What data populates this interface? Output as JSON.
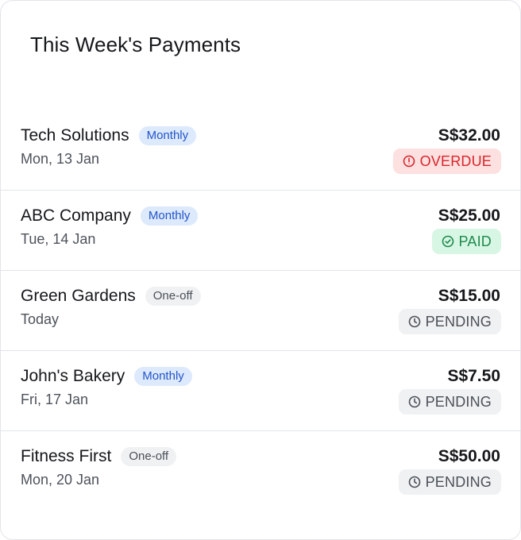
{
  "header": {
    "title": "This Week's Payments"
  },
  "payments": [
    {
      "name": "Tech Solutions",
      "frequency": "Monthly",
      "freq_kind": "monthly",
      "date": "Mon, 13 Jan",
      "amount": "S$32.00",
      "status": "OVERDUE",
      "status_kind": "overdue",
      "status_icon": "alert-circle-icon"
    },
    {
      "name": "ABC Company",
      "frequency": "Monthly",
      "freq_kind": "monthly",
      "date": "Tue, 14 Jan",
      "amount": "S$25.00",
      "status": "PAID",
      "status_kind": "paid",
      "status_icon": "check-circle-icon"
    },
    {
      "name": "Green Gardens",
      "frequency": "One-off",
      "freq_kind": "oneoff",
      "date": "Today",
      "amount": "S$15.00",
      "status": "PENDING",
      "status_kind": "pending",
      "status_icon": "clock-icon"
    },
    {
      "name": "John's Bakery",
      "frequency": "Monthly",
      "freq_kind": "monthly",
      "date": "Fri, 17 Jan",
      "amount": "S$7.50",
      "status": "PENDING",
      "status_kind": "pending",
      "status_icon": "clock-icon"
    },
    {
      "name": "Fitness First",
      "frequency": "One-off",
      "freq_kind": "oneoff",
      "date": "Mon, 20 Jan",
      "amount": "S$50.00",
      "status": "PENDING",
      "status_kind": "pending",
      "status_icon": "clock-icon"
    }
  ],
  "colors": {
    "monthly_badge_bg": "#dde9fc",
    "monthly_badge_text": "#2356c9",
    "overdue_bg": "#fde0e0",
    "overdue_text": "#d8262b",
    "paid_bg": "#d8f6e4",
    "paid_text": "#1e8a4d",
    "pending_bg": "#f0f1f3",
    "pending_text": "#4a4f57"
  }
}
